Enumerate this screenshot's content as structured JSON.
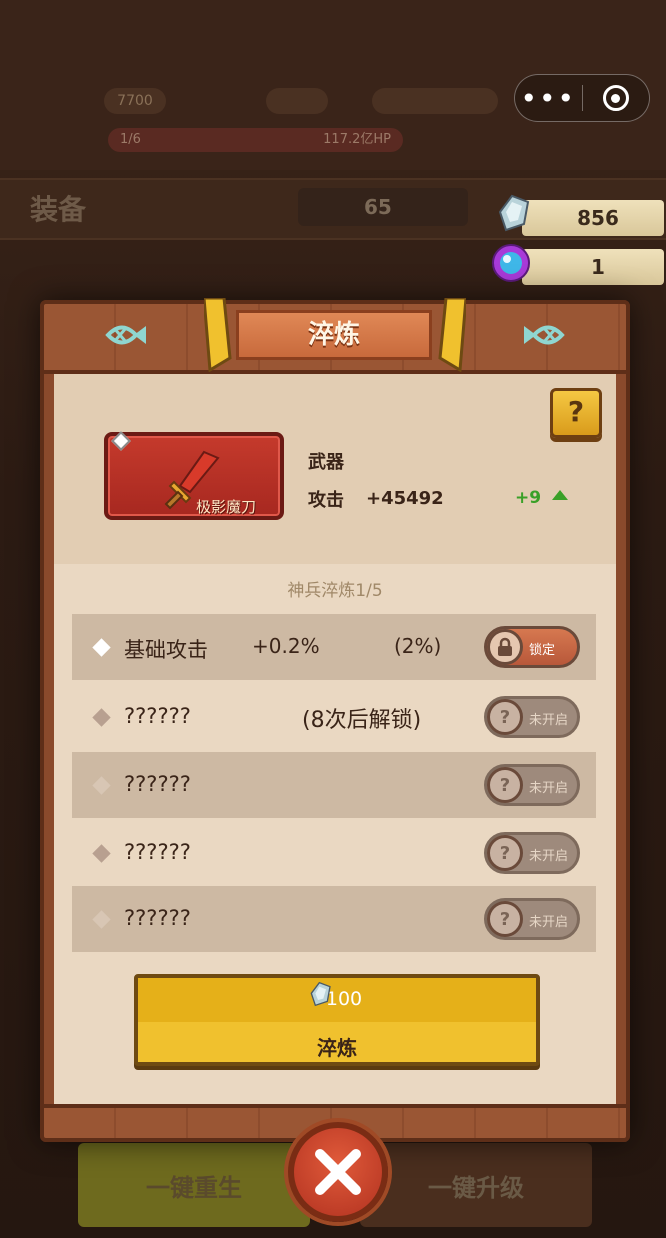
{
  "background": {
    "top_pills": [
      "7700",
      "",
      ""
    ],
    "stage_progress": "1/6",
    "boss_hp": "117.2亿HP",
    "equip_title": "装备",
    "coins": "65",
    "bottom_left_button": "一键重生",
    "bottom_right_button": "一键升级"
  },
  "currency": {
    "crystal": "856",
    "orb": "1"
  },
  "modal": {
    "title": "淬炼",
    "help": "?",
    "item": {
      "name": "极影魔刀",
      "type": "武器",
      "stat_label": "攻击",
      "stat_value": "+45492",
      "level_bonus": "+9"
    },
    "subtitle": "神兵淬炼1/5",
    "rows": [
      {
        "label": "基础攻击",
        "value": "+0.2%",
        "percent": "(2%)",
        "extra": "",
        "toggle": "锁定",
        "toggle_icon": "lock-icon",
        "dark": true,
        "diamond": "#ffffff"
      },
      {
        "label": "??????",
        "value": "",
        "percent": "",
        "extra": "(8次后解锁)",
        "toggle": "未开启",
        "toggle_icon": "question-icon",
        "dark": false,
        "diamond": "#b8a090"
      },
      {
        "label": "??????",
        "value": "",
        "percent": "",
        "extra": "",
        "toggle": "未开启",
        "toggle_icon": "question-icon",
        "dark": true,
        "diamond": "#d8c6b4"
      },
      {
        "label": "??????",
        "value": "",
        "percent": "",
        "extra": "",
        "toggle": "未开启",
        "toggle_icon": "question-icon",
        "dark": false,
        "diamond": "#b8a090"
      },
      {
        "label": "??????",
        "value": "",
        "percent": "",
        "extra": "",
        "toggle": "未开启",
        "toggle_icon": "question-icon",
        "dark": true,
        "diamond": "#d8c6b4"
      }
    ],
    "refine_button": {
      "cost": "100",
      "label": "淬炼"
    }
  },
  "colors": {
    "gold": "#f0c12e",
    "wood": "#8a4a2c",
    "panel": "#ead8c2",
    "close": "#c83c24"
  }
}
